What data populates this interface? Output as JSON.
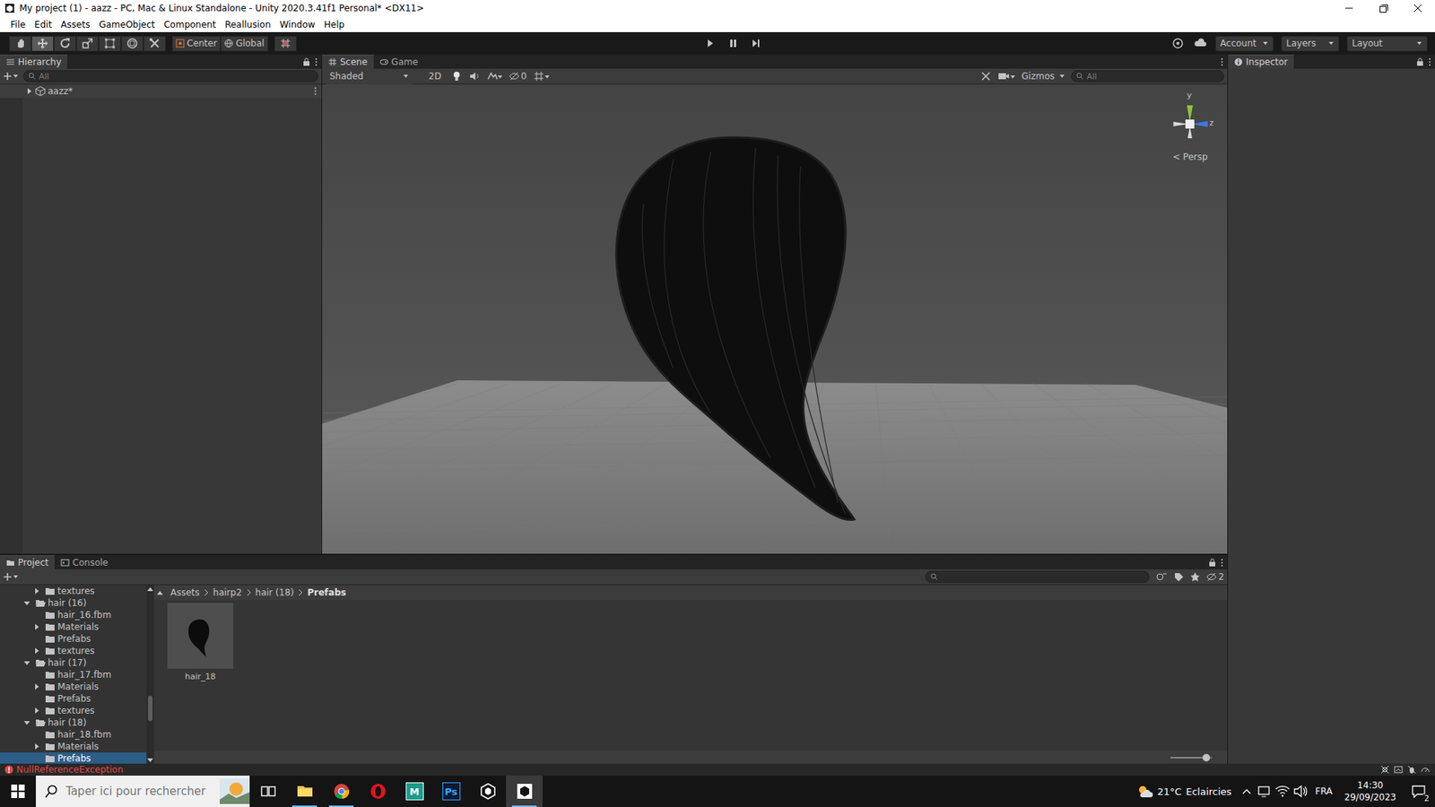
{
  "window": {
    "title": "My project (1) - aazz - PC, Mac & Linux Standalone - Unity 2020.3.41f1 Personal* <DX11>"
  },
  "menu": [
    "File",
    "Edit",
    "Assets",
    "GameObject",
    "Component",
    "Reallusion",
    "Window",
    "Help"
  ],
  "toolbar": {
    "tools": [
      {
        "kind": "hand",
        "selected": false
      },
      {
        "kind": "move",
        "selected": true
      },
      {
        "kind": "rotate",
        "selected": false
      },
      {
        "kind": "scale",
        "selected": false
      },
      {
        "kind": "rect",
        "selected": false
      },
      {
        "kind": "transform",
        "selected": false
      },
      {
        "kind": "custom",
        "selected": false
      }
    ],
    "pivot": "Center",
    "space": "Global",
    "playback": [
      {
        "kind": "play",
        "selected": false
      },
      {
        "kind": "pause",
        "selected": false
      },
      {
        "kind": "step",
        "selected": false
      }
    ],
    "account": "Account",
    "layers": "Layers",
    "layout": "Layout"
  },
  "hierarchy": {
    "tab": "Hierarchy",
    "search_placeholder": "All",
    "items": [
      {
        "label": "aazz*",
        "expanded": false
      }
    ]
  },
  "scene": {
    "tabs": [
      {
        "label": "Scene",
        "selected": true
      },
      {
        "label": "Game",
        "selected": false
      }
    ],
    "shading": "Shaded",
    "mode_2d": {
      "label": "2D",
      "on": false
    },
    "lighting_on": true,
    "hidden_count": "0",
    "gizmos": "Gizmos",
    "search_placeholder": "All",
    "axes": [
      "y",
      "z"
    ],
    "projection": "< Persp"
  },
  "inspector": {
    "tab": "Inspector"
  },
  "project": {
    "tabs": [
      {
        "label": "Project",
        "selected": true
      },
      {
        "label": "Console",
        "selected": false
      }
    ],
    "hidden_count": "2",
    "tree": [
      {
        "label": "textures",
        "depth": 1,
        "expandable": true,
        "expanded": false,
        "selected": false
      },
      {
        "label": "hair (16)",
        "depth": 0,
        "expandable": true,
        "expanded": true,
        "selected": false
      },
      {
        "label": "hair_16.fbm",
        "depth": 1,
        "expandable": false,
        "selected": false
      },
      {
        "label": "Materials",
        "depth": 1,
        "expandable": true,
        "expanded": false,
        "selected": false
      },
      {
        "label": "Prefabs",
        "depth": 1,
        "expandable": false,
        "selected": false
      },
      {
        "label": "textures",
        "depth": 1,
        "expandable": true,
        "expanded": false,
        "selected": false
      },
      {
        "label": "hair (17)",
        "depth": 0,
        "expandable": true,
        "expanded": true,
        "selected": false
      },
      {
        "label": "hair_17.fbm",
        "depth": 1,
        "expandable": false,
        "selected": false
      },
      {
        "label": "Materials",
        "depth": 1,
        "expandable": true,
        "expanded": false,
        "selected": false
      },
      {
        "label": "Prefabs",
        "depth": 1,
        "expandable": false,
        "selected": false
      },
      {
        "label": "textures",
        "depth": 1,
        "expandable": true,
        "expanded": false,
        "selected": false
      },
      {
        "label": "hair (18)",
        "depth": 0,
        "expandable": true,
        "expanded": true,
        "selected": false
      },
      {
        "label": "hair_18.fbm",
        "depth": 1,
        "expandable": false,
        "selected": false
      },
      {
        "label": "Materials",
        "depth": 1,
        "expandable": true,
        "expanded": false,
        "selected": false
      },
      {
        "label": "Prefabs",
        "depth": 1,
        "expandable": false,
        "selected": true
      }
    ],
    "breadcrumb": [
      "Assets",
      "hairp2",
      "hair (18)",
      "Prefabs"
    ],
    "assets": [
      {
        "label": "hair_18",
        "selected": false
      }
    ],
    "icon_size": 0.85
  },
  "status_bar": {
    "message": "NullReferenceException"
  },
  "taskbar": {
    "search_placeholder": "Taper ici pour rechercher",
    "apps": [
      {
        "kind": "taskview",
        "active": false,
        "running": false
      },
      {
        "kind": "explorer",
        "active": false,
        "running": true
      },
      {
        "kind": "chrome",
        "active": false,
        "running": true
      },
      {
        "kind": "opera",
        "active": false,
        "running": false
      },
      {
        "kind": "maya",
        "logo": "M",
        "active": false,
        "running": false
      },
      {
        "kind": "photoshop",
        "logo": "Ps",
        "active": false,
        "running": false
      },
      {
        "kind": "unityhub",
        "active": false,
        "running": false
      },
      {
        "kind": "unity",
        "active": true,
        "running": true
      }
    ],
    "temperature": "21°C",
    "weather": "Eclaircies",
    "language": "FRA",
    "time": "14:30",
    "date": "29/09/2023",
    "notifications": "2"
  }
}
